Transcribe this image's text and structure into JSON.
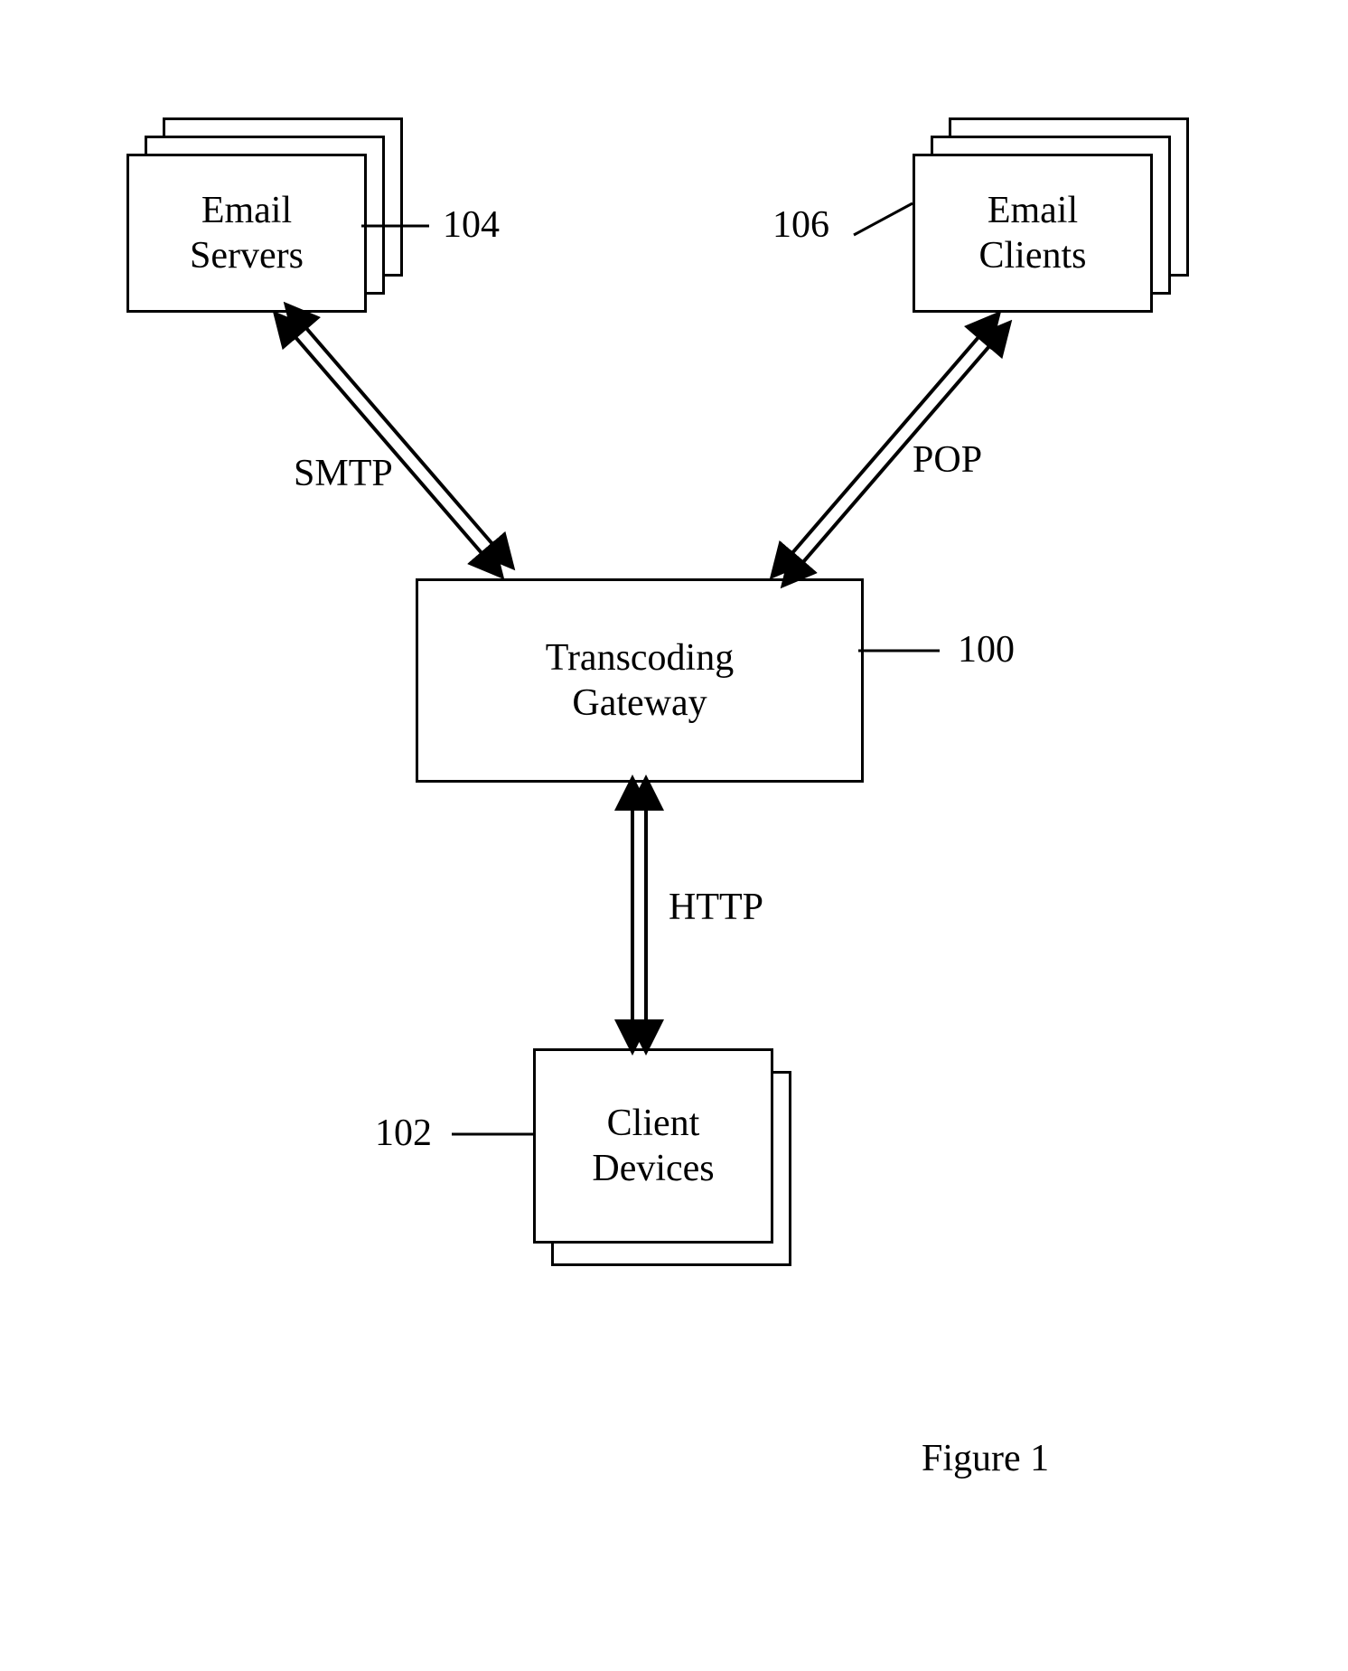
{
  "nodes": {
    "email_servers": {
      "label": "Email\nServers",
      "ref": "104"
    },
    "email_clients": {
      "label": "Email\nClients",
      "ref": "106"
    },
    "transcoding_gateway": {
      "label": "Transcoding\nGateway",
      "ref": "100"
    },
    "client_devices": {
      "label": "Client\nDevices",
      "ref": "102"
    }
  },
  "edges": {
    "smtp": {
      "label": "SMTP"
    },
    "pop": {
      "label": "POP"
    },
    "http": {
      "label": "HTTP"
    }
  },
  "caption": "Figure 1"
}
